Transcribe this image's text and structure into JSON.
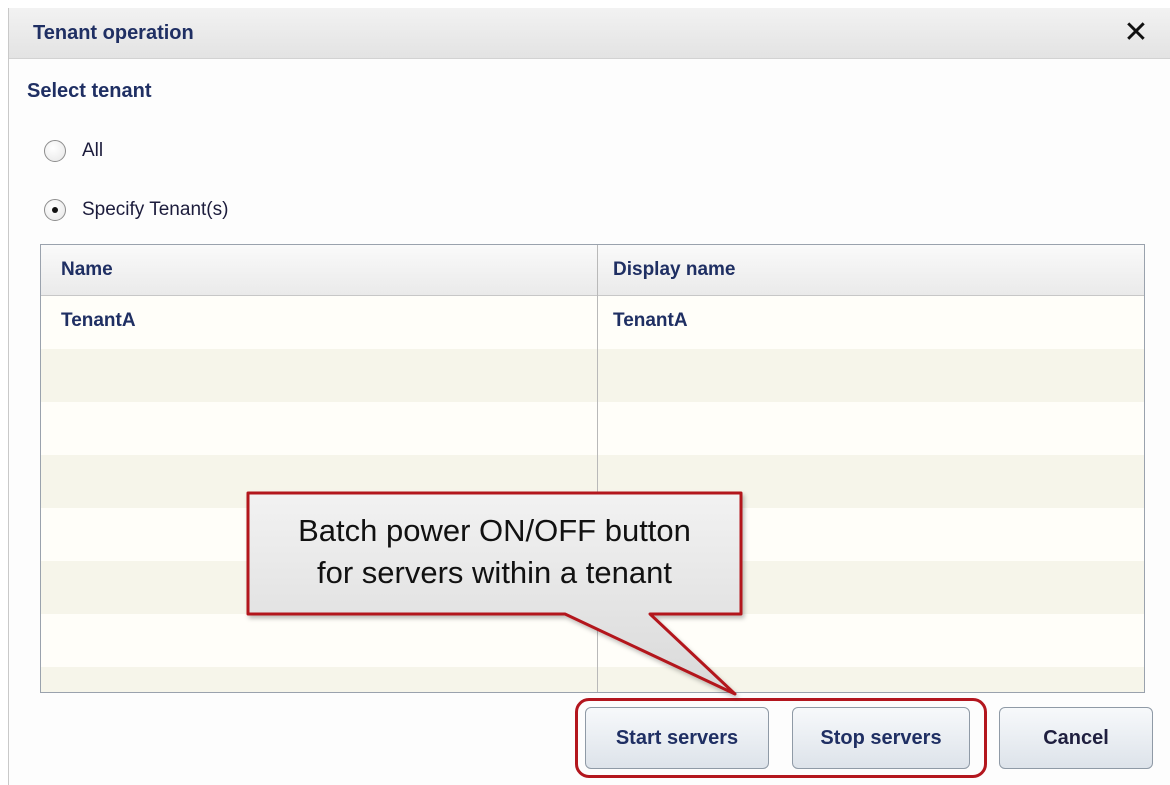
{
  "dialog": {
    "title": "Tenant operation",
    "close_icon": "close-x-icon"
  },
  "select": {
    "heading": "Select tenant",
    "options": [
      {
        "label": "All",
        "selected": false
      },
      {
        "label": "Specify Tenant(s)",
        "selected": true
      }
    ]
  },
  "table": {
    "columns": [
      "Name",
      "Display name"
    ],
    "rows": [
      {
        "name": "TenantA",
        "display_name": "TenantA"
      }
    ]
  },
  "buttons": {
    "start": "Start servers",
    "stop": "Stop servers",
    "cancel": "Cancel"
  },
  "callout": {
    "line1": "Batch power ON/OFF button",
    "line2": "for servers within  a tenant"
  },
  "colors": {
    "text_primary": "#1f2f63",
    "highlight": "#b3161e"
  }
}
